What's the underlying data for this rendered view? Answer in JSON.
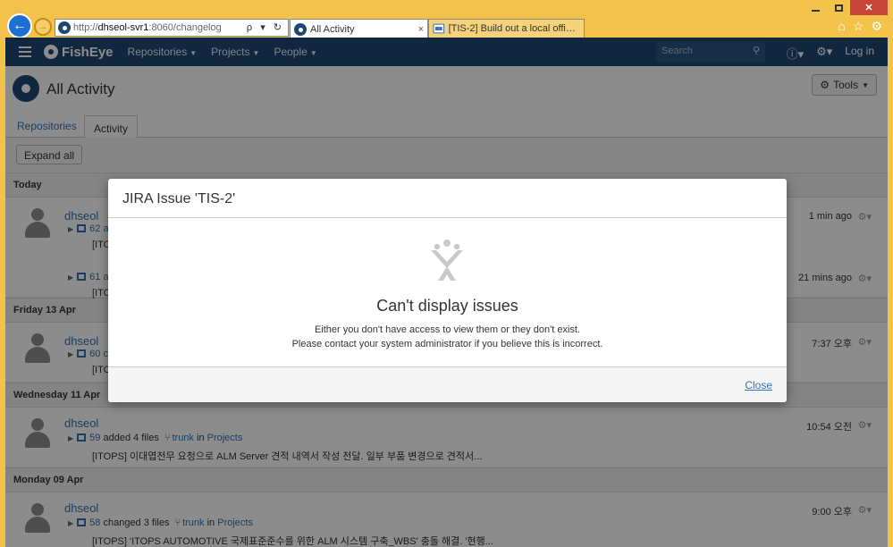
{
  "browser": {
    "url_gray_prefix": "http://",
    "url_host": "dhseol-svr1",
    "url_rest": ":8060/changelog",
    "address_tools": "ρ ▾ ↻",
    "tabs": [
      {
        "title": "All Activity",
        "close": "×"
      },
      {
        "title": "[TIS-2] Build out a local office..."
      }
    ]
  },
  "nav": {
    "brand": "FishEye",
    "items": [
      {
        "label": "Repositories"
      },
      {
        "label": "Projects"
      },
      {
        "label": "People"
      }
    ],
    "search_placeholder": "Search",
    "login": "Log in"
  },
  "header": {
    "title": "All Activity",
    "tools_label": "Tools"
  },
  "tabs": {
    "repositories": "Repositories",
    "activity": "Activity"
  },
  "expand_all": "Expand all",
  "groups": [
    {
      "day": "Today",
      "entries": [
        {
          "user": "dhseol",
          "commit": "62 a",
          "msg": "[ITO",
          "ago": "1 min ago"
        },
        {
          "commit": "61 a",
          "msg": "[ITO",
          "ago": "21 mins ago"
        }
      ]
    },
    {
      "day": "Friday 13 Apr",
      "entries": [
        {
          "user": "dhseol",
          "commit": "60 c",
          "msg": "[ITO",
          "ago": "7:37 오후"
        }
      ]
    },
    {
      "day": "Wednesday 11 Apr",
      "entries": [
        {
          "user": "dhseol",
          "commit": "59",
          "action": "added 4 files",
          "branch": "trunk",
          "in": "in",
          "project": "Projects",
          "msg": "[ITOPS] 이대엽전무 요청으로 ALM Server 견적 내역서 작성 전달. 일부 부품 변경으로 견적서...",
          "ago": "10:54 오전"
        }
      ]
    },
    {
      "day": "Monday 09 Apr",
      "entries": [
        {
          "user": "dhseol",
          "commit": "58",
          "action": "changed 3 files",
          "branch": "trunk",
          "in": "in",
          "project": "Projects",
          "msg": "[ITOPS] 'ITOPS AUTOMOTIVE 국제표준준수를 위한 ALM 시스템 구축_WBS' 충돌 해결. '현행...",
          "ago": "9:00 오후"
        }
      ]
    }
  ],
  "modal": {
    "title": "JIRA Issue 'TIS-2'",
    "heading": "Can't display issues",
    "line1": "Either you don't have access to view them or they don't exist.",
    "line2": "Please contact your system administrator if you believe this is incorrect.",
    "close": "Close"
  }
}
